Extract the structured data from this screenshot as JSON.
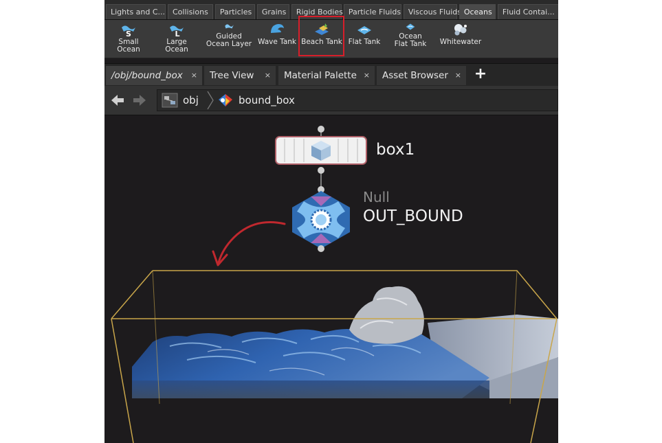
{
  "shelf_tabs": [
    "Lights and C...",
    "Collisions",
    "Particles",
    "Grains",
    "Rigid Bodies",
    "Particle Fluids",
    "Viscous Fluids",
    "Oceans",
    "Fluid Contai..."
  ],
  "active_shelf_tab": "Oceans",
  "tools": [
    {
      "line1": "Small Ocean",
      "line2": "",
      "line3": "",
      "icon": "small-ocean-icon"
    },
    {
      "line1": "Large Ocean",
      "line2": "",
      "line3": "",
      "icon": "large-ocean-icon"
    },
    {
      "line1": "Guided",
      "line2": "Ocean Layer",
      "line3": "",
      "icon": "guided-ocean-layer-icon"
    },
    {
      "line1": "Wave Tank",
      "line2": "",
      "line3": "",
      "icon": "wave-tank-icon"
    },
    {
      "line1": "Beach Tank",
      "line2": "",
      "line3": "",
      "icon": "beach-tank-icon"
    },
    {
      "line1": "Flat Tank",
      "line2": "",
      "line3": "",
      "icon": "flat-tank-icon"
    },
    {
      "line1": "Ocean",
      "line2": "Flat Tank",
      "line3": "",
      "icon": "ocean-flat-tank-icon"
    },
    {
      "line1": "Whitewater",
      "line2": "",
      "line3": "",
      "icon": "whitewater-icon"
    }
  ],
  "highlighted_tool": "Beach Tank",
  "pane_tabs": [
    {
      "label": "/obj/bound_box",
      "close": "×"
    },
    {
      "label": "Tree View",
      "close": "×"
    },
    {
      "label": "Material Palette",
      "close": "×"
    },
    {
      "label": "Asset Browser",
      "close": "×"
    }
  ],
  "add_tab_label": "+",
  "path": {
    "root": "obj",
    "current": "bound_box"
  },
  "nodes": {
    "box": {
      "name": "box1"
    },
    "null": {
      "type": "Null",
      "name": "OUT_BOUND"
    }
  },
  "colors": {
    "highlight": "#d81e2a",
    "bounds": "#c9a64a",
    "water": "#2b5aa0",
    "arrow": "#c0282e"
  }
}
